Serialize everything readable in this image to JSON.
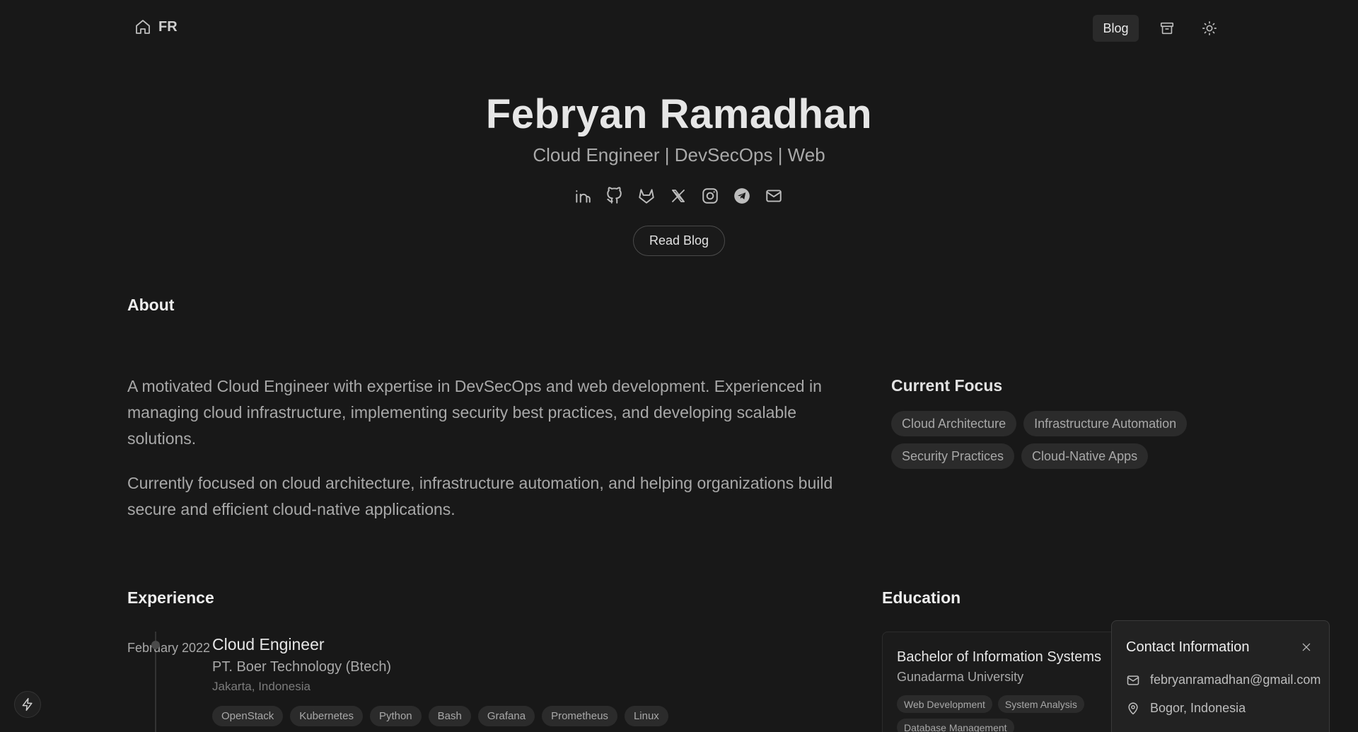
{
  "header": {
    "brand_text": "FR",
    "nav_blog_label": "Blog"
  },
  "hero": {
    "name": "Febryan Ramadhan",
    "subtitle": "Cloud Engineer | DevSecOps | Web",
    "read_blog_label": "Read Blog",
    "socials": [
      "linkedin-icon",
      "github-icon",
      "gitlab-icon",
      "x-icon",
      "instagram-icon",
      "telegram-icon",
      "mail-icon"
    ]
  },
  "about": {
    "title": "About",
    "paragraph1": "A motivated Cloud Engineer with expertise in DevSecOps and web development. Experienced in managing cloud infrastructure, implementing security best practices, and developing scalable solutions.",
    "paragraph2": "Currently focused on cloud architecture, infrastructure automation, and helping organizations build secure and efficient cloud-native applications."
  },
  "focus": {
    "title": "Current Focus",
    "tags": [
      "Cloud Architecture",
      "Infrastructure Automation",
      "Security Practices",
      "Cloud-Native Apps"
    ]
  },
  "experience": {
    "title": "Experience",
    "items": [
      {
        "date": "February 2022",
        "role": "Cloud Engineer",
        "company": "PT. Boer Technology (Btech)",
        "location": "Jakarta, Indonesia",
        "tags": [
          "OpenStack",
          "Kubernetes",
          "Python",
          "Bash",
          "Grafana",
          "Prometheus",
          "Linux"
        ]
      }
    ]
  },
  "education": {
    "title": "Education",
    "items": [
      {
        "degree": "Bachelor of Information Systems",
        "school": "Gunadarma University",
        "tags": [
          "Web Development",
          "System Analysis",
          "Database Management"
        ]
      }
    ]
  },
  "contact": {
    "title": "Contact Information",
    "email": "febryanramadhan@gmail.com",
    "location": "Bogor, Indonesia"
  },
  "colors": {
    "background": "#181818",
    "card": "#222222",
    "tag": "#2b2b2b",
    "text_primary": "#e6e6e6",
    "text_muted": "#a8a8a8"
  }
}
